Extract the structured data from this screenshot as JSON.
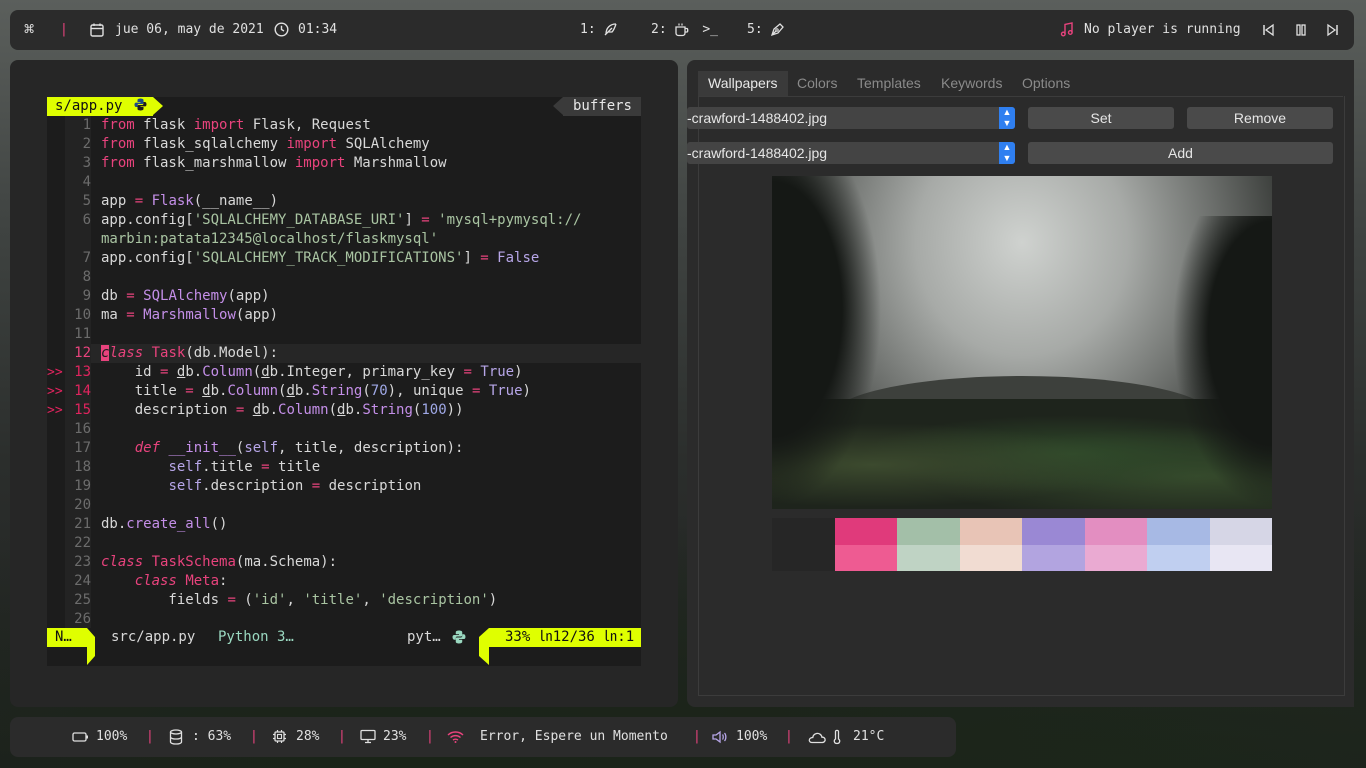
{
  "topbar": {
    "menu_glyph": "⌘",
    "date": "jue 06, may de 2021",
    "time": "01:34",
    "ws1": "1:",
    "ws2": "2:",
    "ws5": "5:",
    "player": "No player is running"
  },
  "editor": {
    "tab_file": "s/app.py",
    "tab_buffers": "buffers",
    "lines": [
      {
        "n": "1",
        "code": [
          [
            "k",
            "from"
          ],
          [
            "",
            "  flask "
          ],
          [
            "k",
            "import"
          ],
          [
            "",
            " Flask, Request"
          ]
        ]
      },
      {
        "n": "2",
        "code": [
          [
            "k",
            "from"
          ],
          [
            "",
            " flask_sqlalchemy "
          ],
          [
            "k",
            "import"
          ],
          [
            "",
            " SQLAlchemy"
          ]
        ]
      },
      {
        "n": "3",
        "code": [
          [
            "k",
            "from"
          ],
          [
            "",
            " flask_marshmallow "
          ],
          [
            "k",
            "import"
          ],
          [
            "",
            " Marshmallow"
          ]
        ]
      }
    ],
    "status": {
      "mode": "N…",
      "file": "src/app.py",
      "ft": "Python 3…",
      "lang": "pyt…",
      "pos": "33% ㏑12/36 ㏑:1"
    }
  },
  "settings": {
    "tabs": [
      "Wallpapers",
      "Colors",
      "Templates",
      "Keywords",
      "Options"
    ],
    "combo1": "-crawford-1488402.jpg",
    "combo2": "-crawford-1488402.jpg",
    "set_label": "Set",
    "remove_label": "Remove",
    "add_label": "Add",
    "palette_top": [
      "#262626",
      "#e03a7b",
      "#a3bfa8",
      "#e8c4b6",
      "#9a88d4",
      "#e38ec1",
      "#a7b9e4",
      "#d6d6e6"
    ],
    "palette_bottom": [
      "#262626",
      "#ee5b92",
      "#bfd3c4",
      "#f1dcd2",
      "#b2a4e0",
      "#eaaad2",
      "#c0cff0",
      "#e8e6f3"
    ]
  },
  "bottombar": {
    "battery": "100%",
    "disk": ": 63%",
    "cpu": "28%",
    "mem": "23%",
    "net": "Error, Espere un Momento",
    "vol": "100%",
    "temp": "21°C"
  }
}
